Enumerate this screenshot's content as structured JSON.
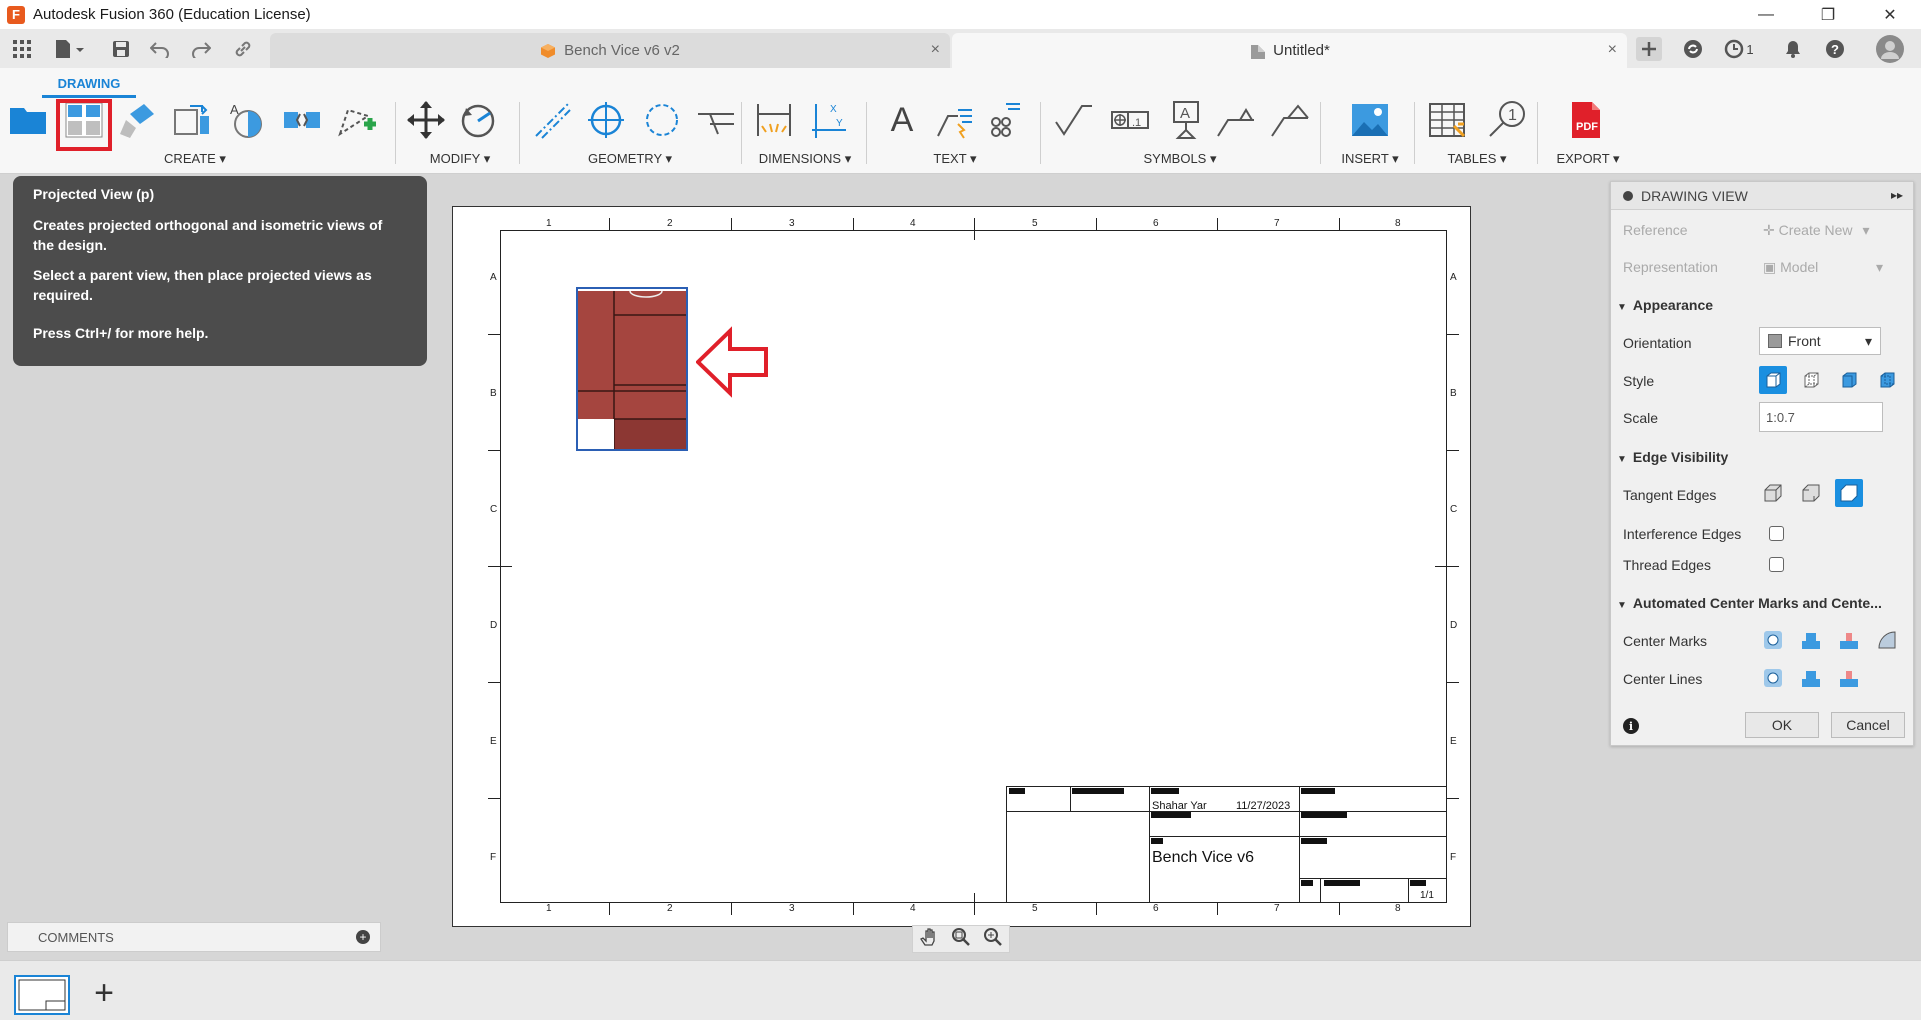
{
  "window": {
    "title": "Autodesk Fusion 360 (Education License)",
    "app_icon_letter": "F",
    "minimize": "—",
    "maximize": "❐",
    "close": "✕"
  },
  "tabs": {
    "items": [
      {
        "label": "Bench Vice v6 v2",
        "active": false
      },
      {
        "label": "Untitled*",
        "active": true
      }
    ],
    "close_glyph": "×",
    "job_count": "1"
  },
  "ribbon": {
    "active_tab": "DRAWING",
    "groups": [
      {
        "label": "CREATE ▾"
      },
      {
        "label": "MODIFY ▾"
      },
      {
        "label": "GEOMETRY ▾"
      },
      {
        "label": "DIMENSIONS ▾"
      },
      {
        "label": "TEXT ▾"
      },
      {
        "label": "SYMBOLS ▾"
      },
      {
        "label": "INSERT ▾"
      },
      {
        "label": "TABLES ▾"
      },
      {
        "label": "EXPORT ▾"
      }
    ],
    "text_tool_glyph": "A",
    "pdf_label": "PDF"
  },
  "tooltip": {
    "title": "Projected View (p)",
    "line1": "Creates projected orthogonal and isometric views of the design.",
    "line2": "Select a parent view, then place projected views as required.",
    "line3": "Press Ctrl+/ for more help."
  },
  "sheet": {
    "col_labels": [
      "1",
      "2",
      "3",
      "4",
      "5",
      "6",
      "7",
      "8"
    ],
    "row_labels": [
      "A",
      "B",
      "C",
      "D",
      "E",
      "F"
    ],
    "title_block": {
      "author": "Shahar Yar",
      "date": "11/27/2023",
      "title": "Bench Vice v6",
      "sheet_num": "1/1"
    }
  },
  "panel": {
    "title": "DRAWING VIEW",
    "collapse_glyph": "▸▸",
    "reference": {
      "label": "Reference",
      "value": "Create New"
    },
    "representation": {
      "label": "Representation",
      "value": "Model"
    },
    "appearance": {
      "header": "Appearance",
      "orientation_label": "Orientation",
      "orientation_value": "Front",
      "style_label": "Style",
      "scale_label": "Scale",
      "scale_value": "1:0.7"
    },
    "edge_visibility": {
      "header": "Edge Visibility",
      "tangent_label": "Tangent Edges",
      "interference_label": "Interference Edges",
      "thread_label": "Thread Edges"
    },
    "center_marks": {
      "header": "Automated Center Marks and Cente...",
      "marks_label": "Center Marks",
      "lines_label": "Center Lines"
    },
    "ok_label": "OK",
    "cancel_label": "Cancel",
    "info_glyph": "i"
  },
  "comments": {
    "label": "COMMENTS",
    "add_glyph": "+"
  },
  "sheetbar": {
    "add_glyph": "+"
  },
  "colors": {
    "accent": "#1a84d6",
    "highlight": "#e0202a",
    "part_fill": "#a5453f",
    "tooltip_bg": "#4c4c4c"
  }
}
